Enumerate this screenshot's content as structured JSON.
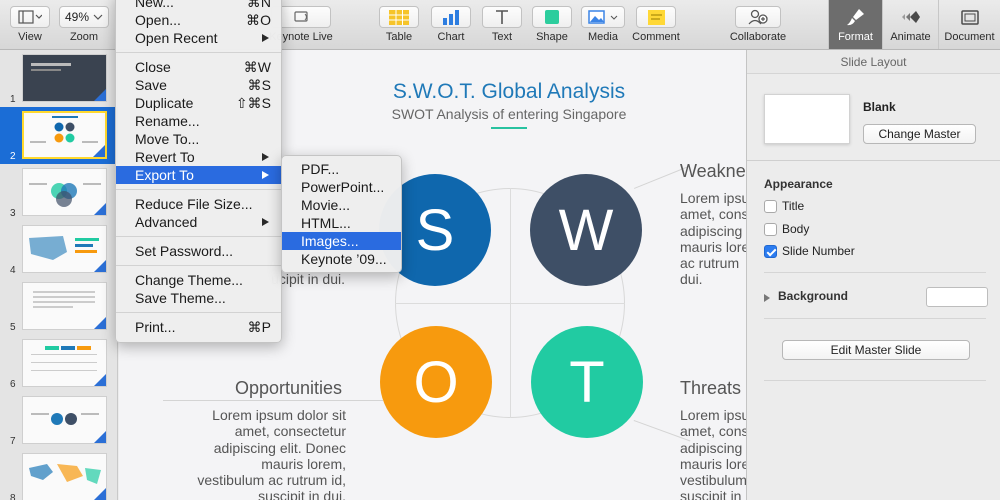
{
  "toolbar": {
    "view_label": "View",
    "zoom_label": "Zoom",
    "zoom_value": "49%",
    "keynote_live_label": "Keynote Live",
    "table_label": "Table",
    "chart_label": "Chart",
    "text_label": "Text",
    "shape_label": "Shape",
    "media_label": "Media",
    "comment_label": "Comment",
    "collaborate_label": "Collaborate",
    "format_label": "Format",
    "animate_label": "Animate",
    "document_label": "Document"
  },
  "navigator": {
    "slides": [
      {
        "number": "1"
      },
      {
        "number": "2"
      },
      {
        "number": "3"
      },
      {
        "number": "4"
      },
      {
        "number": "5"
      },
      {
        "number": "6"
      },
      {
        "number": "7"
      },
      {
        "number": "8"
      }
    ],
    "selected": "2"
  },
  "slide": {
    "title": "S.W.O.T. Global Analysis",
    "subtitle": "SWOT Analysis of entering Singapore",
    "letters": {
      "s": "S",
      "w": "W",
      "o": "O",
      "t": "T"
    },
    "colors": {
      "s": "#0f67ad",
      "w": "#3e4f66",
      "o": "#f79a0e",
      "t": "#21cba2",
      "accent": "#28c2a0"
    },
    "strengths_body_tail": "ucipit in dui.",
    "weaknesses_heading": "Weaknes",
    "weaknesses_body": "Lorem ipsu\namet, cons\nadipiscing\nmauris lore\nac rutrum \ndui.",
    "opportunities_heading": "Opportunities",
    "opportunities_body": "Lorem ipsum dolor sit\namet, consectetur\nadipiscing elit. Donec\nmauris lorem,\nvestibulum ac rutrum id,\nsuscipit in dui.",
    "threats_heading": "Threats",
    "threats_body": "Lorem ipsu\namet, cons\nadipiscing\nmauris lore\nvestibulum\nsuscipit in"
  },
  "file_menu": {
    "items": {
      "partial_top": "New...",
      "partial_top_shortcut": "⌘N",
      "open": "Open...",
      "open_shortcut": "⌘O",
      "open_recent": "Open Recent",
      "close": "Close",
      "close_shortcut": "⌘W",
      "save": "Save",
      "save_shortcut": "⌘S",
      "duplicate": "Duplicate",
      "duplicate_shortcut": "⇧⌘S",
      "rename": "Rename...",
      "move_to": "Move To...",
      "revert_to": "Revert To",
      "export_to": "Export To",
      "reduce_file_size": "Reduce File Size...",
      "advanced": "Advanced",
      "set_password": "Set Password...",
      "change_theme": "Change Theme...",
      "save_theme": "Save Theme...",
      "print": "Print...",
      "print_shortcut": "⌘P"
    }
  },
  "export_menu": {
    "pdf": "PDF...",
    "powerpoint": "PowerPoint...",
    "movie": "Movie...",
    "html": "HTML...",
    "images": "Images...",
    "keynote09": "Keynote ’09..."
  },
  "inspector": {
    "header": "Slide Layout",
    "master_name": "Blank",
    "change_master": "Change Master",
    "appearance": "Appearance",
    "title": "Title",
    "title_checked": false,
    "body": "Body",
    "body_checked": false,
    "slide_number": "Slide Number",
    "slide_number_checked": true,
    "background": "Background",
    "edit_master": "Edit Master Slide"
  }
}
